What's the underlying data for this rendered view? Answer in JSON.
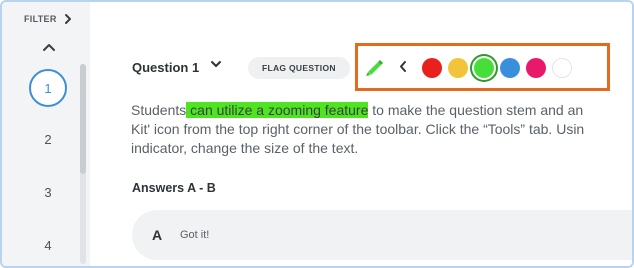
{
  "sidebar": {
    "filter_label": "FILTER",
    "questions": [
      "1",
      "2",
      "3",
      "4"
    ],
    "current": "1"
  },
  "question": {
    "title": "Question 1",
    "flag_label": "FLAG QUESTION",
    "stem_line1_before": "Students",
    "stem_highlight": " can utilize a zooming feature",
    "stem_line1_after": " to make the question stem and an",
    "stem_line2": "Kit' icon from the top right corner of the toolbar. Click the “Tools” tab. Usin",
    "stem_line3": "indicator, change the size of the text."
  },
  "highlighter": {
    "colors": [
      "#e8211c",
      "#f2c43a",
      "#47de3a",
      "#3a8fdc",
      "#e8196a",
      "#ffffff"
    ],
    "selected_index": 2,
    "highlight_color": "#4ee41f"
  },
  "answers": {
    "title": "Answers A - B",
    "items": [
      {
        "letter": "A",
        "text": "Got it!"
      }
    ]
  },
  "colors": {
    "accent": "#3b8fd6",
    "toolbar_border": "#e56a1d"
  }
}
